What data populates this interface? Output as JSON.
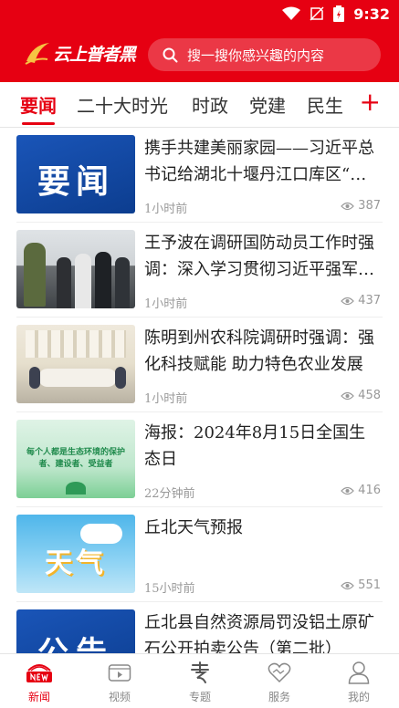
{
  "status_bar": {
    "time": "9:32"
  },
  "header": {
    "logo_text": "云上普者黑",
    "search_placeholder": "搜一搜你感兴趣的内容"
  },
  "tabs": [
    {
      "label": "要闻"
    },
    {
      "label": "二十大时光"
    },
    {
      "label": "时政"
    },
    {
      "label": "党建"
    },
    {
      "label": "民生"
    }
  ],
  "tab_add_label": "+",
  "articles": [
    {
      "title": "携手共建美丽家园——习近平总书记给湖北十堰丹江口库区“绿水青山”作出重要指示",
      "time": "1小时前",
      "views": "387",
      "thumb_text": "要闻"
    },
    {
      "title": "王予波在调研国防动员工作时强调：深入学习贯彻习近平强军思想",
      "time": "1小时前",
      "views": "437",
      "thumb_text": ""
    },
    {
      "title": "陈明到州农科院调研时强调：强化科技赋能 助力特色农业发展",
      "time": "1小时前",
      "views": "458",
      "thumb_text": ""
    },
    {
      "title": "海报：2024年8月15日全国生态日",
      "time": "22分钟前",
      "views": "416",
      "thumb_text": "每个人都是生态环境的保护者、建设者、受益者"
    },
    {
      "title": "丘北天气预报",
      "time": "15小时前",
      "views": "551",
      "thumb_text": "天气"
    },
    {
      "title": "丘北县自然资源局罚没铝土原矿石公开拍卖公告（第二批）",
      "time": "",
      "views": "",
      "thumb_text": "公告"
    }
  ],
  "bottom_nav": [
    {
      "label": "新闻"
    },
    {
      "label": "视频"
    },
    {
      "label": "专题"
    },
    {
      "label": "服务"
    },
    {
      "label": "我的"
    }
  ],
  "colors": {
    "brand_red": "#e60012"
  }
}
